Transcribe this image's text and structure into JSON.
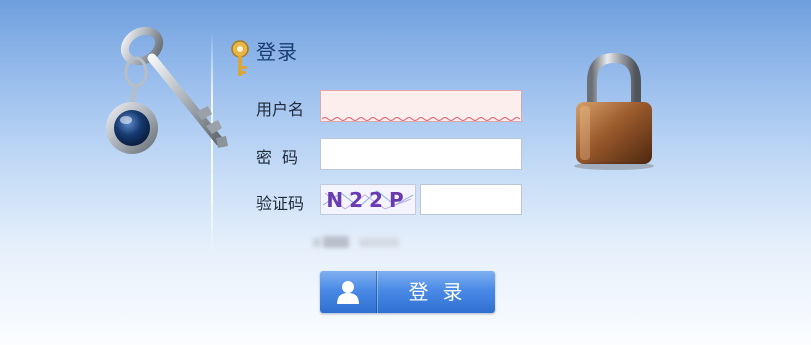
{
  "form": {
    "title": "登录",
    "username_label": "用户名",
    "password_label": "密码",
    "captcha_label": "验证码",
    "captcha_text": "N22P",
    "username_value": "",
    "password_value": "",
    "captcha_value": "",
    "login_label": "登录"
  },
  "icons": {
    "key_illustration": "key-ring-icon",
    "lock_illustration": "padlock-icon",
    "title_icon": "small-key-icon",
    "button_icon": "user-icon"
  },
  "colors": {
    "background_top": "#6f9fdd",
    "background_bottom": "#fbfdff",
    "button": "#3a7bd8",
    "username_error_bg": "#fdeeee",
    "captcha_text": "#6a3ab0"
  }
}
